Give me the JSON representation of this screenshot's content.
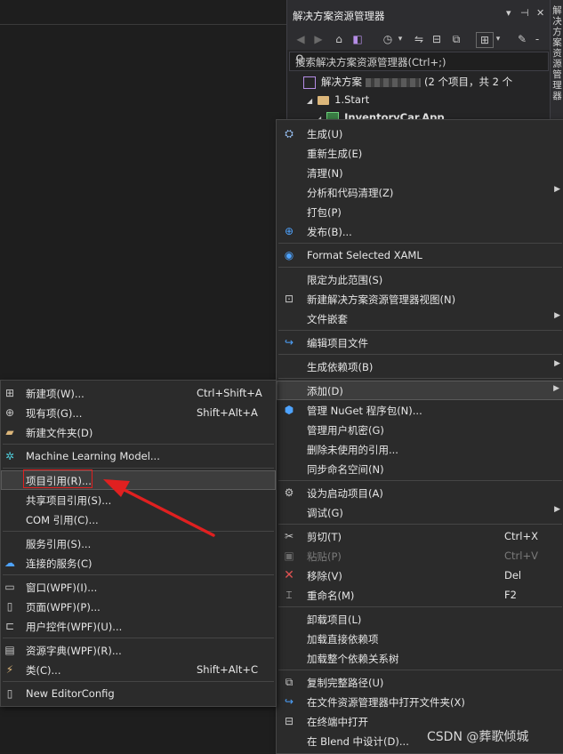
{
  "solution_explorer": {
    "title": "解决方案资源管理器",
    "search_placeholder": "搜索解决方案资源管理器(Ctrl+;)",
    "solution_prefix": "解决方案",
    "solution_suffix": "(2 个项目，共 2 个",
    "folder": "1.Start",
    "project": "InventoryCar.App",
    "side_tab": "解决方案资源管理器"
  },
  "context_menu": {
    "items": [
      {
        "label": "生成(U)"
      },
      {
        "label": "重新生成(E)"
      },
      {
        "label": "清理(N)"
      },
      {
        "label": "分析和代码清理(Z)"
      },
      {
        "label": "打包(P)"
      },
      {
        "label": "发布(B)..."
      },
      {
        "label": "Format Selected XAML"
      },
      {
        "label": "限定为此范围(S)"
      },
      {
        "label": "新建解决方案资源管理器视图(N)"
      },
      {
        "label": "文件嵌套"
      },
      {
        "label": "编辑项目文件"
      },
      {
        "label": "生成依赖项(B)"
      },
      {
        "label": "添加(D)"
      },
      {
        "label": "管理 NuGet 程序包(N)..."
      },
      {
        "label": "管理用户机密(G)"
      },
      {
        "label": "删除未使用的引用..."
      },
      {
        "label": "同步命名空间(N)"
      },
      {
        "label": "设为启动项目(A)"
      },
      {
        "label": "调试(G)"
      },
      {
        "label": "剪切(T)",
        "shortcut": "Ctrl+X"
      },
      {
        "label": "粘贴(P)",
        "shortcut": "Ctrl+V"
      },
      {
        "label": "移除(V)",
        "shortcut": "Del"
      },
      {
        "label": "重命名(M)",
        "shortcut": "F2"
      },
      {
        "label": "卸载项目(L)"
      },
      {
        "label": "加载直接依赖项"
      },
      {
        "label": "加载整个依赖关系树"
      },
      {
        "label": "复制完整路径(U)"
      },
      {
        "label": "在文件资源管理器中打开文件夹(X)"
      },
      {
        "label": "在终端中打开"
      },
      {
        "label": "在 Blend 中设计(D)..."
      }
    ]
  },
  "add_submenu": {
    "items": [
      {
        "label": "新建项(W)...",
        "shortcut": "Ctrl+Shift+A"
      },
      {
        "label": "现有项(G)...",
        "shortcut": "Shift+Alt+A"
      },
      {
        "label": "新建文件夹(D)"
      },
      {
        "label": "Machine Learning Model..."
      },
      {
        "label": "项目引用(R)..."
      },
      {
        "label": "共享项目引用(S)..."
      },
      {
        "label": "COM 引用(C)..."
      },
      {
        "label": "服务引用(S)..."
      },
      {
        "label": "连接的服务(C)"
      },
      {
        "label": "窗口(WPF)(I)..."
      },
      {
        "label": "页面(WPF)(P)..."
      },
      {
        "label": "用户控件(WPF)(U)..."
      },
      {
        "label": "资源字典(WPF)(R)..."
      },
      {
        "label": "类(C)...",
        "shortcut": "Shift+Alt+C"
      },
      {
        "label": "New EditorConfig"
      }
    ]
  },
  "watermark": "CSDN @葬歌倾城",
  "colors": {
    "accent_red": "#e02020",
    "menu_bg": "#2b2b2b",
    "highlight": "#3d3d3d"
  }
}
